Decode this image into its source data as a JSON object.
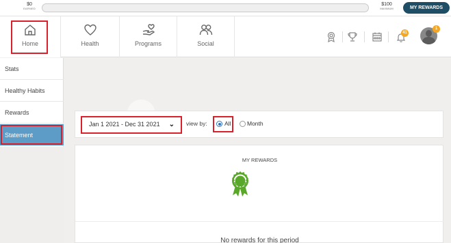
{
  "progress": {
    "earned_amount": "$0",
    "earned_caption": "EARNED",
    "max_amount": "$100",
    "max_caption": "MAXIMUM",
    "percent": 0,
    "rewards_button": "MY REWARDS"
  },
  "nav": {
    "items": [
      {
        "label": "Home",
        "icon": "home-icon"
      },
      {
        "label": "Health",
        "icon": "heart-icon"
      },
      {
        "label": "Programs",
        "icon": "hand-heart-icon"
      },
      {
        "label": "Social",
        "icon": "people-icon"
      }
    ],
    "right_icons": [
      "award-icon",
      "trophy-icon",
      "calendar-icon",
      "bell-icon",
      "avatar"
    ],
    "bell_badge": "41",
    "avatar_badge": "1"
  },
  "sidebar": {
    "items": [
      {
        "label": "Stats"
      },
      {
        "label": "Healthy Habits"
      },
      {
        "label": "Rewards"
      },
      {
        "label": "Statement",
        "active": true
      }
    ]
  },
  "filter": {
    "date_range": "Jan 1 2021 - Dec 31 2021",
    "view_by_label": "view by:",
    "options": [
      "All",
      "Month"
    ],
    "selected": "All"
  },
  "rewards_panel": {
    "title": "MY REWARDS",
    "empty_message": "No rewards for this period"
  },
  "colors": {
    "accent": "#1d4e66",
    "active_sidebar": "#5d9cc7",
    "highlight": "#d9202a",
    "ribbon": "#5aa82a"
  }
}
